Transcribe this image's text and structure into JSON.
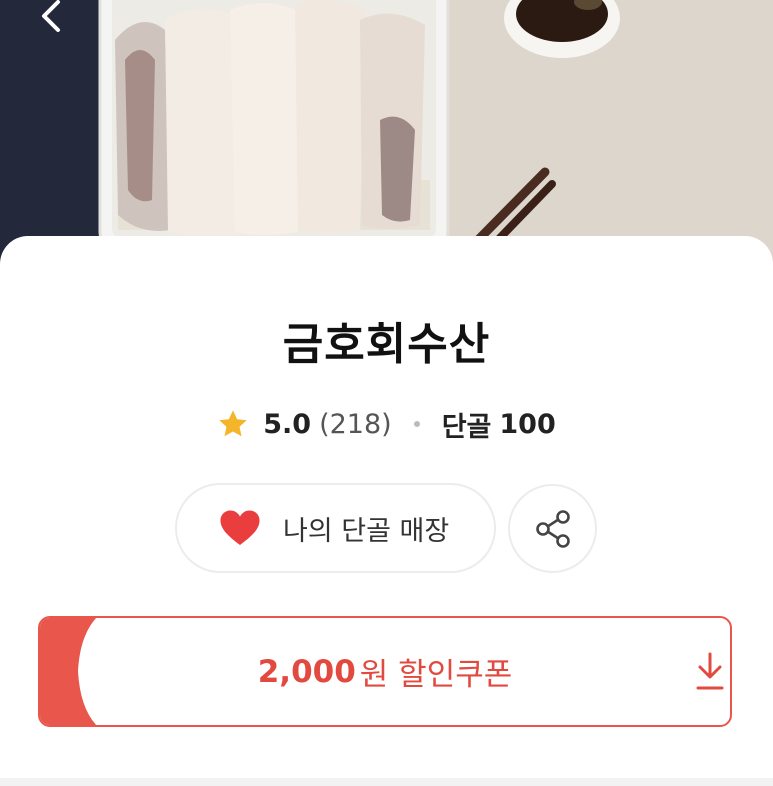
{
  "header": {
    "back_icon": "chevron-left-icon"
  },
  "store": {
    "name": "금호회수산"
  },
  "rating": {
    "star_icon": "star-icon",
    "score": "5.0",
    "count": "(218)",
    "regular_label": "단골",
    "regular_count": "100"
  },
  "actions": {
    "favorite_label": "나의 단골 매장",
    "favorite_icon": "heart-icon",
    "share_icon": "share-icon"
  },
  "coupon": {
    "amount": "2,000",
    "suffix": "원 할인쿠폰",
    "download_icon": "download-icon"
  },
  "colors": {
    "accent": "#e9564c",
    "heart": "#ea3e3e",
    "star": "#f5b52b",
    "title": "#111111"
  }
}
